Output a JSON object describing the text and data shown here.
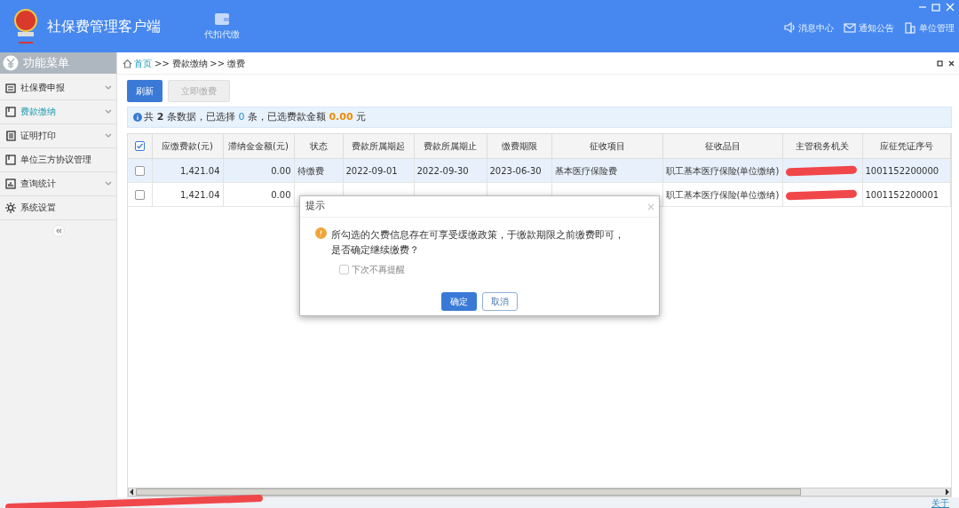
{
  "app": {
    "title": "社保费管理客户端",
    "toolbar": [
      {
        "label": "代扣代缴"
      }
    ],
    "header_links": [
      {
        "label": "消息中心"
      },
      {
        "label": "通知公告"
      },
      {
        "label": "单位管理"
      }
    ]
  },
  "sidebar": {
    "title": "功能菜单",
    "items": [
      {
        "label": "社保费申报",
        "expandable": true,
        "selected": false
      },
      {
        "label": "费款缴纳",
        "expandable": true,
        "selected": true
      },
      {
        "label": "证明打印",
        "expandable": true,
        "selected": false
      },
      {
        "label": "单位三方协议管理",
        "expandable": false,
        "selected": false
      },
      {
        "label": "查询统计",
        "expandable": true,
        "selected": false
      },
      {
        "label": "系统设置",
        "expandable": false,
        "selected": false
      }
    ]
  },
  "breadcrumb": [
    {
      "label": "首页",
      "link": true
    },
    {
      "label": ">>",
      "link": false
    },
    {
      "label": "费款缴纳",
      "link": false
    },
    {
      "label": ">>",
      "link": false
    },
    {
      "label": "缴费",
      "link": false
    }
  ],
  "buttons": [
    {
      "label": "刷新",
      "disabled": false
    },
    {
      "label": "立即缴费",
      "disabled": true
    }
  ],
  "info": {
    "labels": [
      "共",
      "条数据，已选择",
      "条，已选费款金额",
      "元"
    ],
    "total": "2",
    "selected_count": "0",
    "amount": "0.00"
  },
  "table": {
    "all_checked": true,
    "columns": [
      "应缴费款(元)",
      "滞纳金金额(元)",
      "状态",
      "费款所属期起",
      "费款所属期止",
      "缴费期限",
      "征收项目",
      "征收品目",
      "主管税务机关",
      "应征凭证序号"
    ],
    "rows": [
      {
        "checked": false,
        "selected": true,
        "cells": [
          "1,421.04",
          "0.00",
          "待缴费",
          "2022-09-01",
          "2022-09-30",
          "2023-06-30",
          "基本医疗保险费",
          "职工基本医疗保险(单位缴纳)",
          {
            "redacted": true
          },
          "1001152200000"
        ]
      },
      {
        "checked": false,
        "selected": false,
        "cells": [
          "1,421.04",
          "0.00",
          null,
          null,
          null,
          null,
          null,
          "职工基本医疗保险(单位缴纳)",
          {
            "redacted": true
          },
          "1001152200001"
        ]
      }
    ]
  },
  "dialog": {
    "title": "提示",
    "message": "所勾选的欠费信息存在可享受缓缴政策，于缴款期限之前缴费即可，是否确定继续缴费？",
    "checkbox": {
      "label": "下次不再提醒",
      "checked": false
    },
    "buttons": [
      {
        "label": "确定",
        "primary": true
      },
      {
        "label": "取消",
        "primary": false
      }
    ]
  },
  "status_bar": {
    "redacted": true,
    "link": "关于"
  }
}
